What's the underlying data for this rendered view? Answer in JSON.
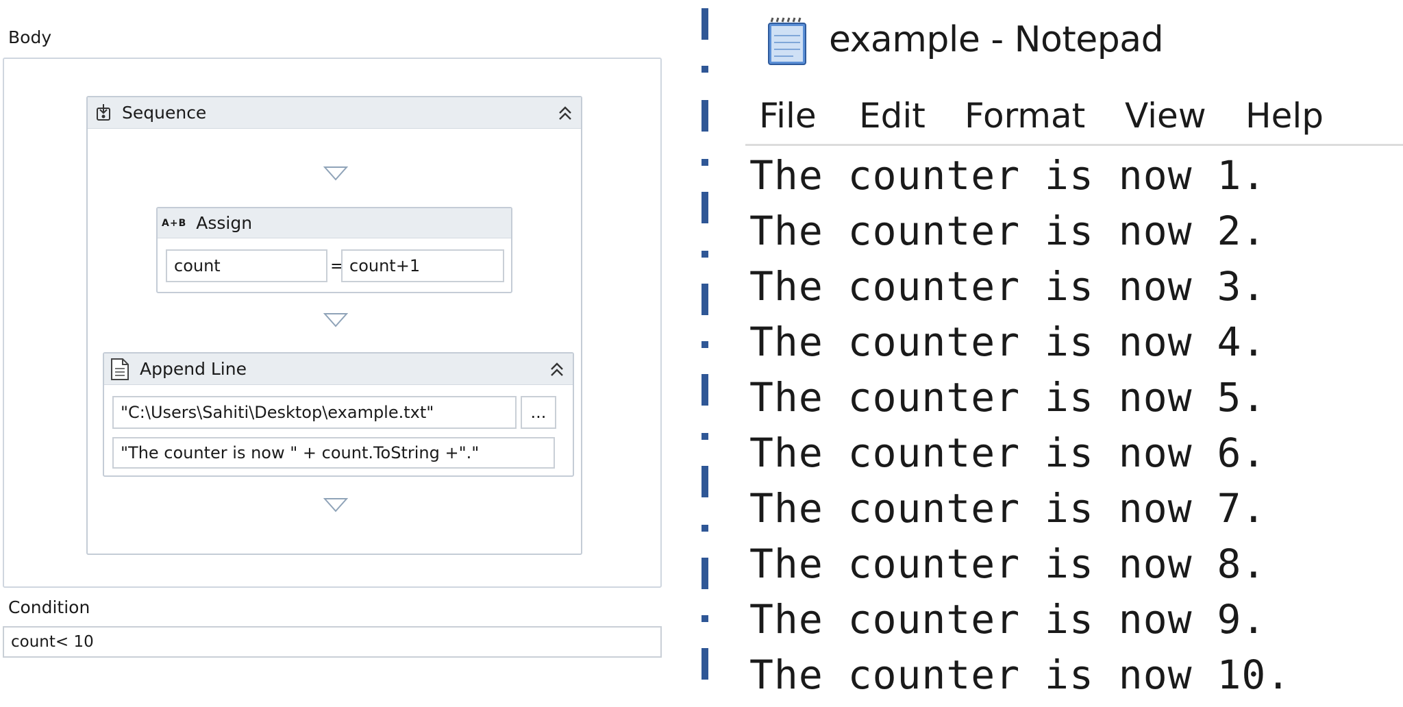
{
  "workflow": {
    "body_label": "Body",
    "condition_label": "Condition",
    "condition_value": "count< 10",
    "sequence": {
      "title": "Sequence"
    },
    "assign": {
      "title": "Assign",
      "icon_text": "A+B",
      "to_value": "count",
      "equals": "=",
      "value": "count+1"
    },
    "append_line": {
      "title": "Append Line",
      "file_path": "\"C:\\Users\\Sahiti\\Desktop\\example.txt\"",
      "browse_label": "...",
      "text_value": "\"The counter is now \" + count.ToString +\".\""
    }
  },
  "notepad": {
    "title": "example - Notepad",
    "menu": [
      "File",
      "Edit",
      "Format",
      "View",
      "Help"
    ],
    "lines": [
      "The counter is now 1.",
      "The counter is now 2.",
      "The counter is now 3.",
      "The counter is now 4.",
      "The counter is now 5.",
      "The counter is now 6.",
      "The counter is now 7.",
      "The counter is now 8.",
      "The counter is now 9.",
      "The counter is now 10."
    ]
  },
  "colors": {
    "divider_blue": "#2f5796",
    "activity_header": "#e9edf1",
    "activity_border": "#c4ccd6"
  }
}
